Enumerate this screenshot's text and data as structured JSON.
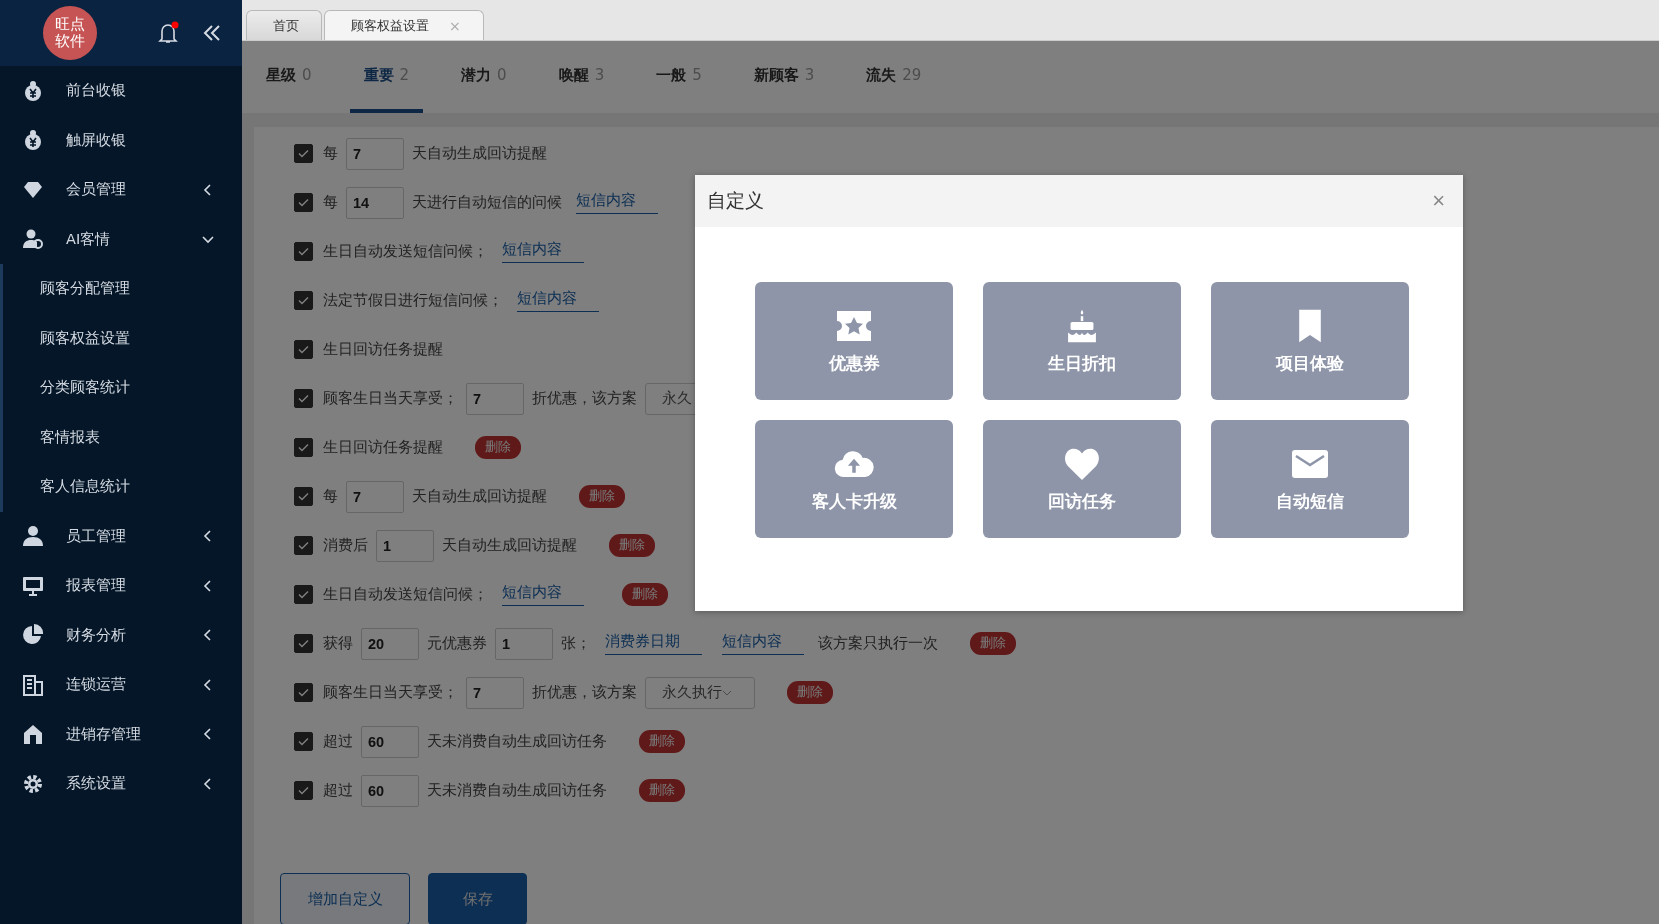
{
  "sidebar": {
    "logo": {
      "lines": [
        "旺点",
        "软件"
      ]
    },
    "items": [
      {
        "label": "前台收银",
        "kind": "plain"
      },
      {
        "label": "触屏收银",
        "kind": "plain"
      },
      {
        "label": "会员管理",
        "kind": "group",
        "expanded": false
      },
      {
        "label": "AI客情",
        "kind": "group",
        "expanded": true,
        "children": [
          {
            "label": "顾客分配管理"
          },
          {
            "label": "顾客权益设置"
          },
          {
            "label": "分类顾客统计"
          },
          {
            "label": "客情报表"
          },
          {
            "label": "客人信息统计"
          }
        ]
      },
      {
        "label": "员工管理",
        "kind": "group",
        "expanded": false
      },
      {
        "label": "报表管理",
        "kind": "group",
        "expanded": false
      },
      {
        "label": "财务分析",
        "kind": "group",
        "expanded": false
      },
      {
        "label": "连锁运营",
        "kind": "group",
        "expanded": false
      },
      {
        "label": "进销存管理",
        "kind": "group",
        "expanded": false
      },
      {
        "label": "系统设置",
        "kind": "group",
        "expanded": false
      }
    ]
  },
  "page_tabs": [
    {
      "label": "首页",
      "selected": false
    },
    {
      "label": "顾客权益设置",
      "selected": true,
      "close": "×"
    }
  ],
  "category_tabs": [
    {
      "label": "星级",
      "count": "0",
      "selected": false
    },
    {
      "label": "重要",
      "count": "2",
      "selected": true
    },
    {
      "label": "潜力",
      "count": "0",
      "selected": false
    },
    {
      "label": "唤醒",
      "count": "3",
      "selected": false
    },
    {
      "label": "一般",
      "count": "5",
      "selected": false
    },
    {
      "label": "新顾客",
      "count": "3",
      "selected": false
    },
    {
      "label": "流失",
      "count": "29",
      "selected": false
    }
  ],
  "rules": [
    {
      "checked": true,
      "parts": [
        {
          "kind": "text",
          "text": "每"
        },
        {
          "kind": "input",
          "value": "7"
        },
        {
          "kind": "text",
          "text": "天自动生成回访提醒"
        }
      ]
    },
    {
      "checked": true,
      "parts": [
        {
          "kind": "text",
          "text": "每"
        },
        {
          "kind": "input",
          "value": "14"
        },
        {
          "kind": "text",
          "text": "天进行自动短信的问候"
        },
        {
          "kind": "link",
          "text": "短信内容"
        }
      ]
    },
    {
      "checked": true,
      "parts": [
        {
          "kind": "text",
          "text": "生日自动发送短信问候；"
        },
        {
          "kind": "link",
          "text": "短信内容"
        }
      ]
    },
    {
      "checked": true,
      "parts": [
        {
          "kind": "text",
          "text": "法定节假日进行短信问候；"
        },
        {
          "kind": "link",
          "text": "短信内容"
        }
      ]
    },
    {
      "checked": true,
      "parts": [
        {
          "kind": "text",
          "text": "生日回访任务提醒"
        }
      ]
    },
    {
      "checked": true,
      "parts": [
        {
          "kind": "text",
          "text": "顾客生日当天享受；"
        },
        {
          "kind": "input",
          "value": "7"
        },
        {
          "kind": "text",
          "text": "折优惠，该方案"
        },
        {
          "kind": "select",
          "value": "永久"
        }
      ]
    },
    {
      "checked": true,
      "parts": [
        {
          "kind": "text",
          "text": "生日回访任务提醒"
        },
        {
          "kind": "delete",
          "text": "删除"
        }
      ]
    },
    {
      "checked": true,
      "parts": [
        {
          "kind": "text",
          "text": "每"
        },
        {
          "kind": "input",
          "value": "7"
        },
        {
          "kind": "text",
          "text": "天自动生成回访提醒"
        },
        {
          "kind": "delete",
          "text": "删除"
        }
      ]
    },
    {
      "checked": true,
      "parts": [
        {
          "kind": "text",
          "text": "消费后"
        },
        {
          "kind": "input",
          "value": "1"
        },
        {
          "kind": "text",
          "text": "天自动生成回访提醒"
        },
        {
          "kind": "delete",
          "text": "删除"
        }
      ]
    },
    {
      "checked": true,
      "parts": [
        {
          "kind": "text",
          "text": "生日自动发送短信问候；"
        },
        {
          "kind": "link",
          "text": "短信内容"
        },
        {
          "kind": "delete",
          "text": "删除"
        }
      ]
    },
    {
      "checked": true,
      "parts": [
        {
          "kind": "text",
          "text": "获得"
        },
        {
          "kind": "input",
          "value": "20"
        },
        {
          "kind": "text",
          "text": "元优惠券"
        },
        {
          "kind": "input",
          "value": "1"
        },
        {
          "kind": "text",
          "text": "张；"
        },
        {
          "kind": "link",
          "text": "消费券日期"
        },
        {
          "kind": "link",
          "text": "短信内容"
        },
        {
          "kind": "text",
          "text": "该方案只执行一次"
        },
        {
          "kind": "delete",
          "text": "删除"
        }
      ]
    },
    {
      "checked": true,
      "parts": [
        {
          "kind": "text",
          "text": "顾客生日当天享受；"
        },
        {
          "kind": "input",
          "value": "7"
        },
        {
          "kind": "text",
          "text": "折优惠，该方案"
        },
        {
          "kind": "select",
          "value": "永久执行",
          "caret": true
        },
        {
          "kind": "delete",
          "text": "删除"
        }
      ]
    },
    {
      "checked": true,
      "parts": [
        {
          "kind": "text",
          "text": "超过"
        },
        {
          "kind": "input",
          "value": "60"
        },
        {
          "kind": "text",
          "text": "天未消费自动生成回访任务"
        },
        {
          "kind": "delete",
          "text": "删除"
        }
      ]
    },
    {
      "checked": true,
      "parts": [
        {
          "kind": "text",
          "text": "超过"
        },
        {
          "kind": "input",
          "value": "60"
        },
        {
          "kind": "text",
          "text": "天未消费自动生成回访任务"
        },
        {
          "kind": "delete",
          "text": "删除"
        }
      ]
    }
  ],
  "buttons": [
    {
      "label": "增加自定义",
      "kind": "secondary"
    },
    {
      "label": "保存",
      "kind": "primary"
    }
  ],
  "dialog": {
    "title": "自定义",
    "close": "×",
    "options": [
      {
        "label": "优惠券"
      },
      {
        "label": "生日折扣"
      },
      {
        "label": "项目体验"
      },
      {
        "label": "客人卡升级"
      },
      {
        "label": "回访任务"
      },
      {
        "label": "自动短信"
      }
    ]
  }
}
